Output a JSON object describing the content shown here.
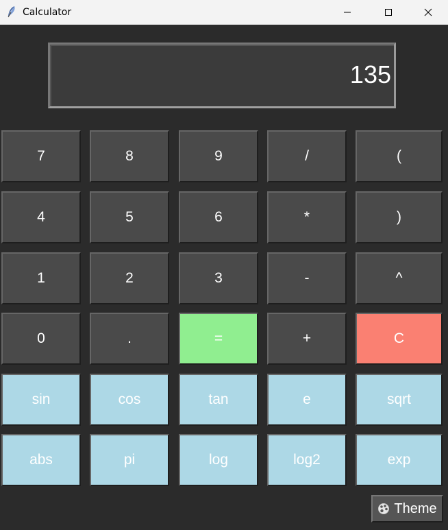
{
  "window": {
    "title": "Calculator",
    "icon": "feather-icon",
    "controls": [
      "minimize-icon",
      "maximize-icon",
      "close-icon"
    ]
  },
  "display": {
    "value": "135"
  },
  "keys": {
    "row1": [
      "7",
      "8",
      "9",
      "/",
      "("
    ],
    "row2": [
      "4",
      "5",
      "6",
      "*",
      ")"
    ],
    "row3": [
      "1",
      "2",
      "3",
      "-",
      "^"
    ],
    "row4": [
      "0",
      ".",
      "=",
      "+",
      "C"
    ],
    "row5": [
      "sin",
      "cos",
      "tan",
      "e",
      "sqrt"
    ],
    "row6": [
      "abs",
      "pi",
      "log",
      "log2",
      "exp"
    ]
  },
  "theme_button": {
    "label": "Theme",
    "icon": "palette-icon"
  },
  "colors": {
    "background": "#2b2b2b",
    "key": "#4a4a4a",
    "equals": "#90ee90",
    "clear": "#fa8072",
    "function": "#add8e6",
    "display": "#3b3b3b"
  }
}
